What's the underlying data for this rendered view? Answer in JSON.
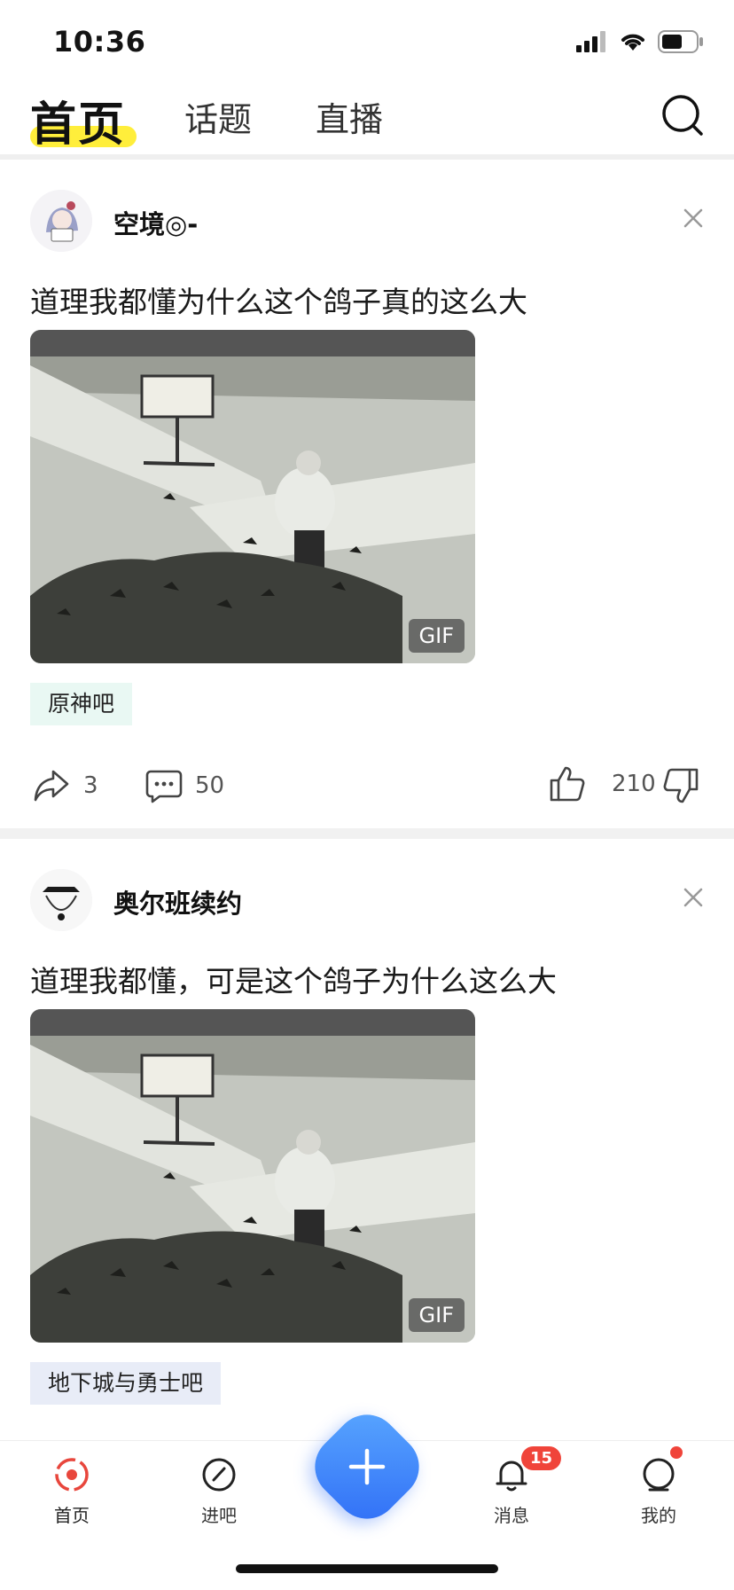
{
  "status_bar": {
    "time": "10:36"
  },
  "nav": {
    "tabs": [
      {
        "label": "首页",
        "active": true
      },
      {
        "label": "话题",
        "active": false
      },
      {
        "label": "直播",
        "active": false
      }
    ],
    "highlight_color": "#ffee3b"
  },
  "posts": [
    {
      "author": "空境◎-",
      "title": "道理我都懂为什么这个鸽子真的这么大",
      "media_badge": "GIF",
      "forum_tag": "原神吧",
      "forum_tag_bg": "#e9f8f3",
      "share_count": "3",
      "comment_count": "50",
      "like_count": "210"
    },
    {
      "author": "奥尔班续约",
      "title": "道理我都懂，可是这个鸽子为什么这么大",
      "media_badge": "GIF",
      "forum_tag": "地下城与勇士吧",
      "forum_tag_bg": "#e8ecf7"
    }
  ],
  "tabbar": {
    "items": [
      {
        "label": "首页",
        "icon": "home-target-icon"
      },
      {
        "label": "进吧",
        "icon": "compass-icon"
      },
      {
        "label": "消息",
        "icon": "bell-icon",
        "badge": "15"
      },
      {
        "label": "我的",
        "icon": "chat-bubble-icon",
        "dot": true
      }
    ],
    "fab_icon": "plus-icon"
  }
}
